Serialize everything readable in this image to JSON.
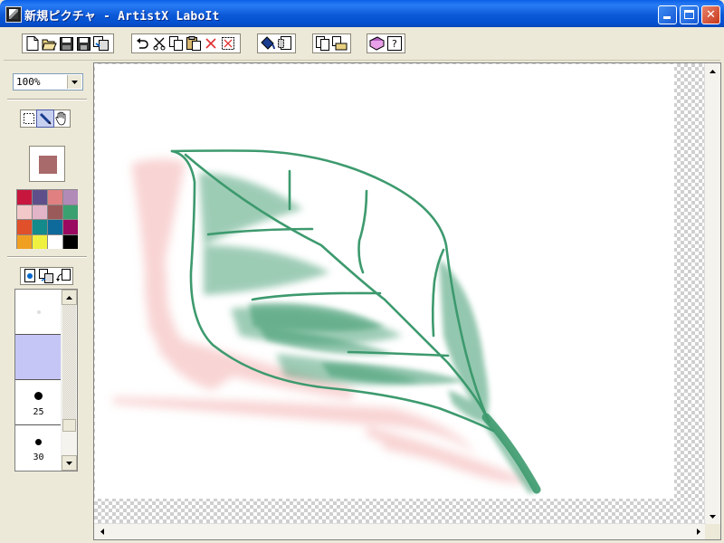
{
  "window": {
    "title": "新規ピクチャ - ArtistX LaboIt"
  },
  "title_buttons": [
    "minimize",
    "maximize",
    "close"
  ],
  "toolbar": {
    "groups": [
      [
        "new-icon",
        "open-icon",
        "save-icon",
        "save-as-icon",
        "export-icon"
      ],
      [
        "undo-icon",
        "cut-icon",
        "copy-icon",
        "paste-icon",
        "delete-icon",
        "select-all-icon"
      ],
      [
        "fill-icon",
        "clear-icon"
      ],
      [
        "duplicate-icon",
        "import-icon"
      ],
      [
        "help-book-icon",
        "about-icon"
      ]
    ]
  },
  "left_panel": {
    "zoom": "100%",
    "tools": [
      "select-icon",
      "pen-icon",
      "hand-icon"
    ],
    "current_color": "#a86a6a",
    "palette": [
      "#c8173f",
      "#5e4f8a",
      "#e08080",
      "#b28ab8",
      "#f2c8c8",
      "#e2b4c8",
      "#9a5a5a",
      "#3aa070",
      "#e0502a",
      "#158a8a",
      "#0e6a9a",
      "#9a0a60",
      "#f0a020",
      "#f0f040",
      "#ffffff",
      "#000000"
    ],
    "layer_tools": [
      "new-layer-icon",
      "copy-layer-icon",
      "rotate-layer-icon"
    ],
    "brushes": [
      {
        "label": "",
        "dot": 3,
        "faint": true
      },
      {
        "label": "",
        "selected": true
      },
      {
        "label": "25",
        "dot": 9
      },
      {
        "label": "30",
        "dot": 7
      }
    ]
  },
  "canvas": {
    "background": "#ffffff",
    "stroke_color": "#3d9a6e",
    "pink_color": "#f7c6c6"
  }
}
